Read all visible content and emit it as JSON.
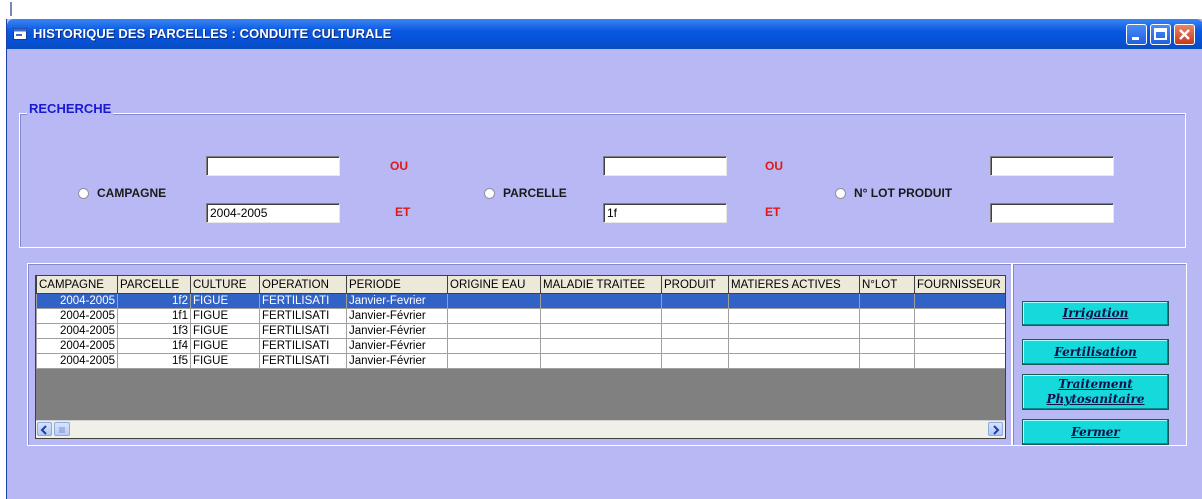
{
  "window": {
    "title": "HISTORIQUE DES PARCELLES : CONDUITE CULTURALE",
    "controls": [
      "minimize-icon",
      "maximize-icon",
      "close-icon"
    ]
  },
  "search": {
    "group_label": "RECHERCHE",
    "campagne": {
      "label": "CAMPAGNE",
      "field_top": "",
      "field_bottom": "2004-2005"
    },
    "parcelle": {
      "label": "PARCELLE",
      "field_top": "",
      "field_bottom": "1f"
    },
    "lot": {
      "label": "N° LOT PRODUIT",
      "field_top": "",
      "field_bottom": ""
    },
    "ou_label": "OU",
    "et_label": "ET"
  },
  "grid": {
    "columns": [
      "CAMPAGNE",
      "PARCELLE",
      "CULTURE",
      "OPERATION",
      "PERIODE",
      "ORIGINE EAU",
      "MALADIE TRAITEE",
      "PRODUIT",
      "MATIERES ACTIVES",
      "N°LOT",
      "FOURNISSEUR"
    ],
    "rows": [
      [
        "2004-2005",
        "1f2",
        "FIGUE",
        "FERTILISATI",
        "Janvier-Fevrier",
        "",
        "",
        "",
        "",
        "",
        ""
      ],
      [
        "2004-2005",
        "1f1",
        "FIGUE",
        "FERTILISATI",
        "Janvier-Février",
        "",
        "",
        "",
        "",
        "",
        ""
      ],
      [
        "2004-2005",
        "1f3",
        "FIGUE",
        "FERTILISATI",
        "Janvier-Février",
        "",
        "",
        "",
        "",
        "",
        ""
      ],
      [
        "2004-2005",
        "1f4",
        "FIGUE",
        "FERTILISATI",
        "Janvier-Février",
        "",
        "",
        "",
        "",
        "",
        ""
      ],
      [
        "2004-2005",
        "1f5",
        "FIGUE",
        "FERTILISATI",
        "Janvier-Février",
        "",
        "",
        "",
        "",
        "",
        ""
      ]
    ],
    "selected_row": 0
  },
  "actions": {
    "irrigation": "Irrigation",
    "fertilisation": "Fertilisation",
    "traitement_line1": "Traitement",
    "traitement_line2": "Phytosanitaire",
    "fermer": "Fermer"
  },
  "colors": {
    "window_bg": "#b8b9f4",
    "titlebar": "#0552d8",
    "group_label": "#1a1ad0",
    "connector_red": "#e01818",
    "action_button": "#16d9dc",
    "selected_row": "#3163c6"
  }
}
